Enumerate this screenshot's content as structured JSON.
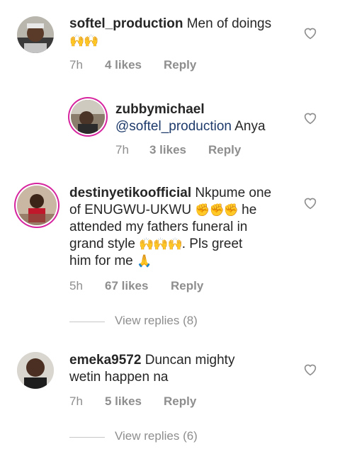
{
  "comments": [
    {
      "username": "softel_production",
      "text": "Men of doings",
      "emoji": "🙌🙌",
      "time": "7h",
      "likes": "4 likes",
      "reply": "Reply"
    },
    {
      "username": "zubbymichael",
      "mention": "@softel_production",
      "text": "Anya",
      "time": "7h",
      "likes": "3 likes",
      "reply": "Reply"
    },
    {
      "username": "destinyetikoofficial",
      "line1": "Nkpume one",
      "line2": "of ENUGWU-UKWU",
      "emoji2": "✊✊✊",
      "line2b": "he",
      "line3": "attended my fathers funeral in",
      "line4": "grand style",
      "emoji4": "🙌🙌🙌",
      "line4b": ". Pls greet",
      "line5": "him for me",
      "emoji5": "🙏",
      "time": "5h",
      "likes": "67 likes",
      "reply": "Reply",
      "view_replies": "View replies (8)"
    },
    {
      "username": "emeka9572",
      "line1": "Duncan mighty",
      "line2": "wetin happen na",
      "time": "7h",
      "likes": "5 likes",
      "reply": "Reply",
      "view_replies": "View replies (6)"
    }
  ],
  "colors": {
    "ring": "#d6249f",
    "mention": "#1d3a6b",
    "meta": "#8e8e8e"
  },
  "icons": [
    "avatar",
    "heart-icon"
  ]
}
